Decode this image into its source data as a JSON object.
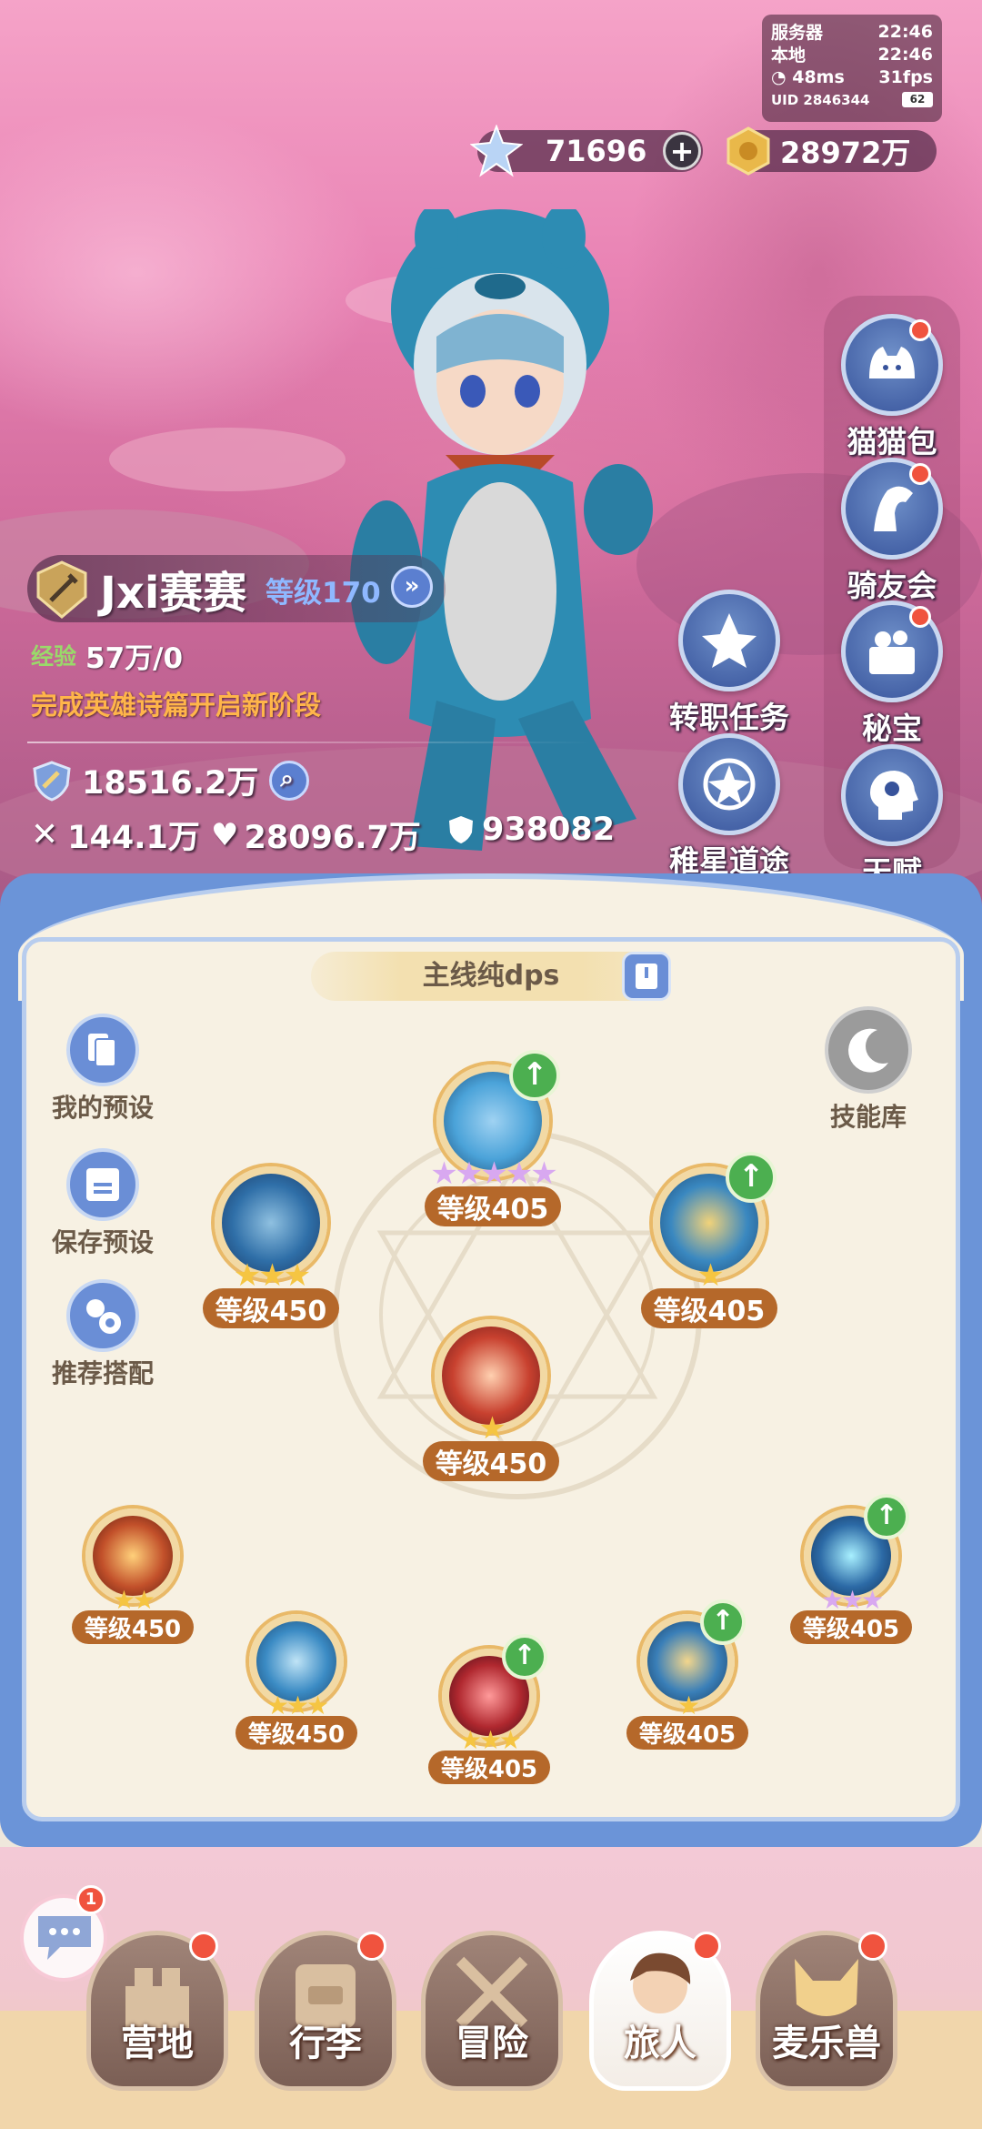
{
  "status": {
    "server_label": "服务器",
    "server_time": "22:46",
    "local_label": "本地",
    "local_time": "22:46",
    "ping": "48ms",
    "fps": "31fps",
    "uid": "UID 2846344",
    "battery": "62"
  },
  "currency": {
    "gems": "71696",
    "coins": "28972万"
  },
  "features": [
    {
      "label": "猫猫包",
      "icon": "cat-bag-icon",
      "badge": true
    },
    {
      "label": "骑友会",
      "icon": "horse-icon",
      "badge": true
    },
    {
      "label": "秘宝",
      "icon": "treasure-icon",
      "badge": true
    },
    {
      "label": "天赋",
      "icon": "talent-icon",
      "badge": false
    },
    {
      "label": "转职任务",
      "icon": "class-change-icon",
      "badge": false
    },
    {
      "label": "稚星道途",
      "icon": "star-path-icon",
      "badge": false
    }
  ],
  "player": {
    "name": "Jxi赛赛",
    "level": "等级170",
    "exp_label": "经验",
    "exp_value": "57万/0",
    "hint": "完成英雄诗篇开启新阶段",
    "power": "18516.2万",
    "attack": "144.1万",
    "hp": "28096.7万",
    "defense": "938082"
  },
  "skills_panel": {
    "preset_name": "主线纯dps",
    "left_buttons": [
      "我的预设",
      "保存预设",
      "推荐搭配"
    ],
    "skill_library": "技能库",
    "skills": [
      {
        "id": "top",
        "level": "等级405",
        "stars": "★★★★★",
        "star_color": "#d8a8f0",
        "upgrade": true,
        "color": "#4ba3d9"
      },
      {
        "id": "left",
        "level": "等级450",
        "stars": "★★★",
        "star_color": "#f5c542",
        "upgrade": false,
        "color": "#2f6fa8"
      },
      {
        "id": "right",
        "level": "等级405",
        "stars": "★",
        "star_color": "#f5c542",
        "upgrade": true,
        "color": "#3a88c0"
      },
      {
        "id": "center",
        "level": "等级450",
        "stars": "★",
        "star_color": "#f5c542",
        "upgrade": false,
        "color": "#c8412f"
      },
      {
        "id": "bl1",
        "level": "等级450",
        "stars": "★★",
        "star_color": "#f5c542",
        "upgrade": false,
        "color": "#c2502a"
      },
      {
        "id": "bl2",
        "level": "等级450",
        "stars": "★★★",
        "star_color": "#f5c542",
        "upgrade": false,
        "color": "#3b8bc4"
      },
      {
        "id": "bc",
        "level": "等级405",
        "stars": "★★★",
        "star_color": "#f5c542",
        "upgrade": true,
        "color": "#b0282f"
      },
      {
        "id": "br2",
        "level": "等级405",
        "stars": "★",
        "star_color": "#f5c542",
        "upgrade": true,
        "color": "#3a7fb8"
      },
      {
        "id": "br1",
        "level": "等级405",
        "stars": "★★★",
        "star_color": "#d8a8f0",
        "upgrade": true,
        "color": "#2c6aa6"
      }
    ]
  },
  "chat_badge": "1",
  "nav": [
    {
      "label": "营地",
      "badge": true,
      "active": false
    },
    {
      "label": "行李",
      "badge": true,
      "active": false
    },
    {
      "label": "冒险",
      "badge": false,
      "active": false
    },
    {
      "label": "旅人",
      "badge": true,
      "active": true
    },
    {
      "label": "麦乐兽",
      "badge": true,
      "active": false
    }
  ]
}
